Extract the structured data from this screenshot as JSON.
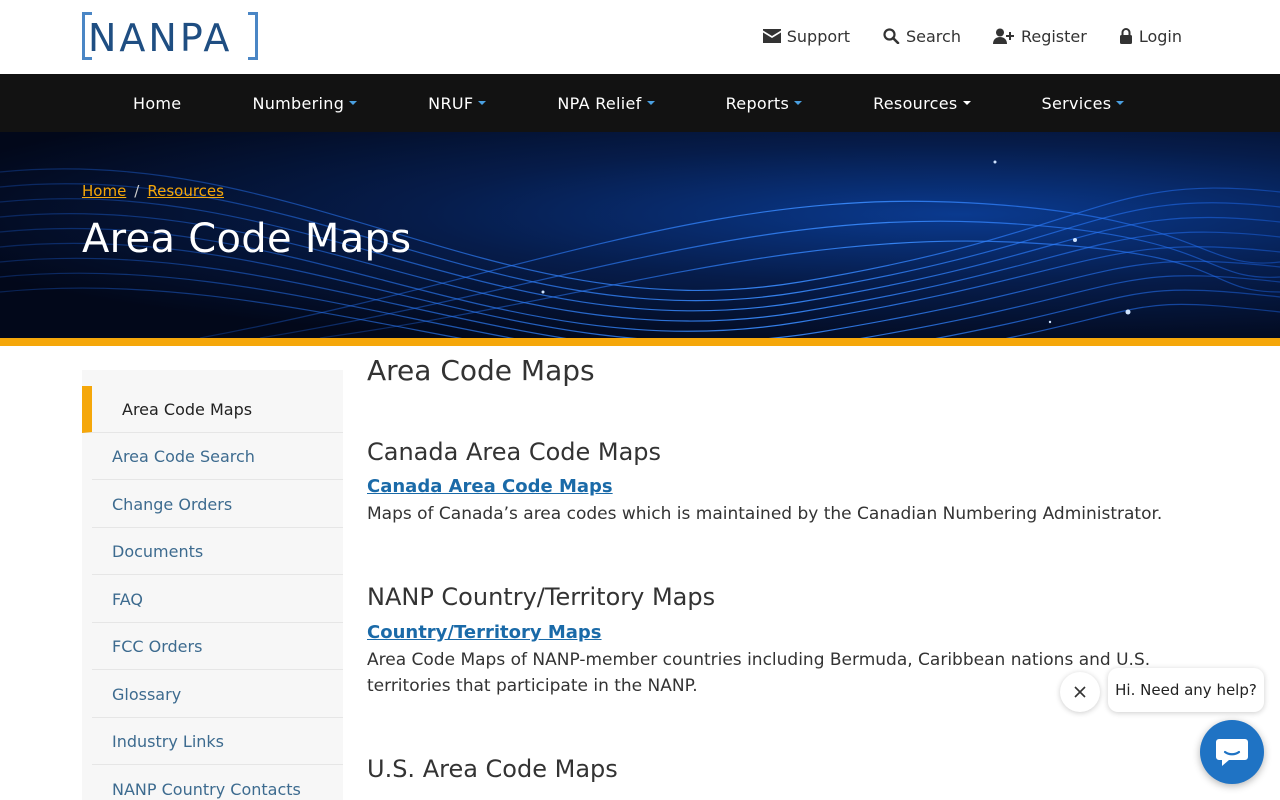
{
  "header": {
    "logo_text": "NANPA",
    "utility": [
      {
        "label": "Support",
        "icon": "envelope-icon"
      },
      {
        "label": "Search",
        "icon": "search-icon"
      },
      {
        "label": "Register",
        "icon": "user-plus-icon"
      },
      {
        "label": "Login",
        "icon": "lock-icon"
      }
    ]
  },
  "nav": {
    "items": [
      {
        "label": "Home"
      },
      {
        "label": "Numbering"
      },
      {
        "label": "NRUF"
      },
      {
        "label": "NPA Relief"
      },
      {
        "label": "Reports"
      },
      {
        "label": "Resources"
      },
      {
        "label": "Services"
      }
    ]
  },
  "hero": {
    "breadcrumb": [
      "Home",
      "Resources"
    ],
    "breadcrumb_separator": "/",
    "title": "Area Code Maps"
  },
  "sidebar": {
    "items": [
      {
        "label": "Area Code Maps"
      },
      {
        "label": "Area Code Search"
      },
      {
        "label": "Change Orders"
      },
      {
        "label": "Documents"
      },
      {
        "label": "FAQ"
      },
      {
        "label": "FCC Orders"
      },
      {
        "label": "Glossary"
      },
      {
        "label": "Industry Links"
      },
      {
        "label": "NANP Country Contacts"
      }
    ]
  },
  "content": {
    "title": "Area Code Maps",
    "sections": [
      {
        "heading": "Canada Area Code Maps",
        "link": "Canada Area Code Maps",
        "description": "Maps of Canada’s area codes which is maintained by the Canadian Numbering Administrator."
      },
      {
        "heading": "NANP Country/Territory Maps",
        "link": "Country/Territory Maps",
        "description": "Area Code Maps of NANP-member countries including Bermuda, Caribbean nations and U.S. territories that participate in the NANP."
      },
      {
        "heading": "U.S. Area Code Maps"
      }
    ]
  },
  "chat": {
    "greeting": "Hi. Need any help?"
  },
  "colors": {
    "accent": "#f5a70a",
    "nav_bg": "#121212",
    "link": "#1a6aa8",
    "chat": "#1f73c4"
  }
}
